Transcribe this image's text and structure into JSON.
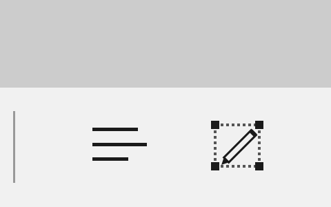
{
  "window": {
    "background_color": "#f1f1f1",
    "header_color": "#cccccc"
  },
  "toolbar": {
    "separator_color": "#999999",
    "icon_color": "#1a1a1a",
    "buttons": [
      {
        "icon": "text-align-left-icon"
      },
      {
        "icon": "edit-selection-icon"
      }
    ]
  }
}
